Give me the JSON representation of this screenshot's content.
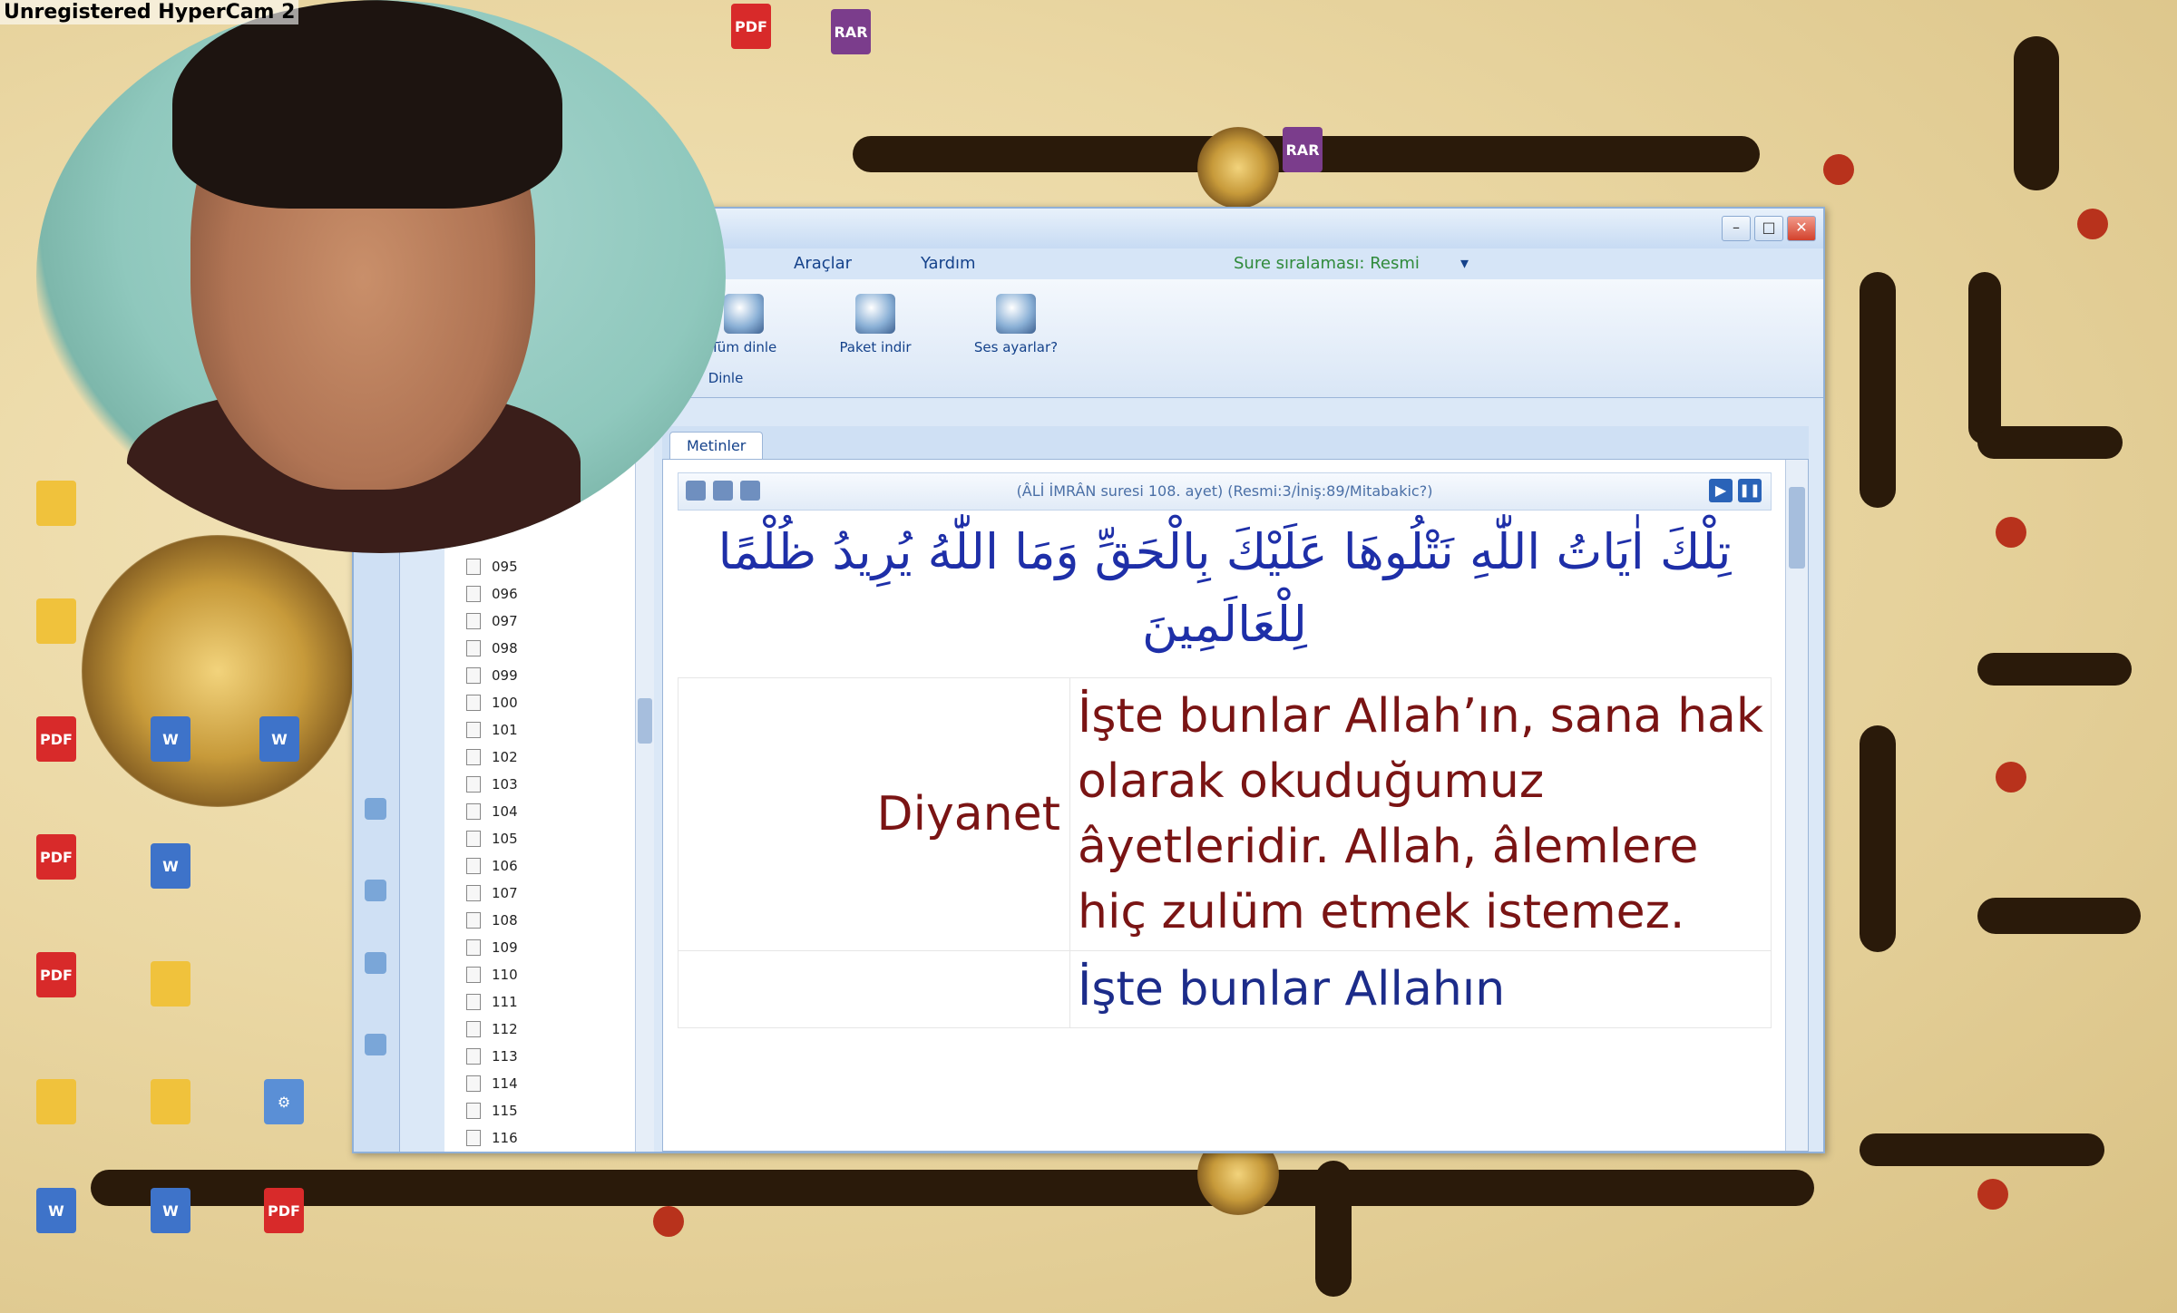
{
  "overlay": {
    "recorder_label": "Unregistered HyperCam 2"
  },
  "desktop_icons": [
    {
      "id": "d1",
      "type": "pdf",
      "glyph": "PDF"
    },
    {
      "id": "d2",
      "type": "rar",
      "glyph": "RAR"
    },
    {
      "id": "d3",
      "type": "rar",
      "glyph": "RAR"
    },
    {
      "id": "d4",
      "type": "folder",
      "glyph": ""
    },
    {
      "id": "d5",
      "type": "folder",
      "glyph": ""
    },
    {
      "id": "d6",
      "type": "pdf",
      "glyph": "PDF"
    },
    {
      "id": "d7",
      "type": "pdf",
      "glyph": "PDF"
    },
    {
      "id": "d8",
      "type": "pdf",
      "glyph": "PDF"
    },
    {
      "id": "d9",
      "type": "folder",
      "glyph": ""
    },
    {
      "id": "d10",
      "type": "doc",
      "glyph": "W"
    },
    {
      "id": "d11",
      "type": "doc",
      "glyph": "W"
    },
    {
      "id": "d12",
      "type": "doc",
      "glyph": "W"
    },
    {
      "id": "d13",
      "type": "folder",
      "glyph": ""
    },
    {
      "id": "d14",
      "type": "folder",
      "glyph": ""
    },
    {
      "id": "d15",
      "type": "doc",
      "glyph": "W"
    },
    {
      "id": "d16",
      "type": "doc",
      "glyph": "W"
    },
    {
      "id": "d17",
      "type": "pdf",
      "glyph": "PDF"
    },
    {
      "id": "d18",
      "type": "app",
      "glyph": "⚙"
    }
  ],
  "app": {
    "menu": {
      "item1": "Araçlar",
      "item2": "Yardım",
      "item3": "Sure sıralaması: Resmi"
    },
    "ribbon": {
      "buttons": [
        {
          "label": "Tüm dinle"
        },
        {
          "label": "Paket indir"
        },
        {
          "label": "Ses ayarlar?"
        }
      ],
      "group_label": "Dinle"
    },
    "list_items": [
      "095",
      "096",
      "097",
      "098",
      "099",
      "100",
      "101",
      "102",
      "103",
      "104",
      "105",
      "106",
      "107",
      "108",
      "109",
      "110",
      "111",
      "112",
      "113",
      "114",
      "115",
      "116"
    ],
    "tab_label": "Metinler",
    "verse_ref": "(ÂLİ İMRÂN suresi 108. ayet) (Resmi:3/İniş:89/Mitabakic?)",
    "arabic_text": "تِلْكَ اٰيَاتُ اللّٰهِ نَتْلُوهَا عَلَيْكَ بِالْحَقِّ وَمَا اللّٰهُ يُرِيدُ ظُلْمًا لِلْعَالَمِينَ",
    "translation": {
      "source": "Diyanet",
      "text": "İşte bunlar Allah’ın, sana hak olarak okuduğumuz âyetleridir. Allah, âlemlere hiç zulüm etmek istemez.",
      "next_text": "İşte bunlar Allahın"
    }
  }
}
